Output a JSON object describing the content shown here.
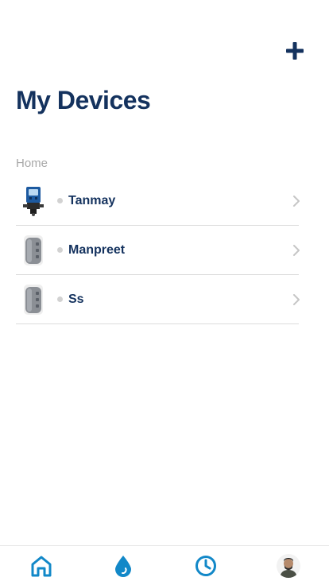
{
  "header": {
    "title": "My Devices",
    "add_icon": "plus-icon"
  },
  "section": {
    "label": "Home"
  },
  "devices": [
    {
      "name": "Tanmay",
      "thumbnail": "water-meter-device-image",
      "status_color": "#d2d2d2"
    },
    {
      "name": "Manpreet",
      "thumbnail": "water-tank-device-image",
      "status_color": "#d2d2d2"
    },
    {
      "name": "Ss",
      "thumbnail": "water-tank-device-image",
      "status_color": "#d2d2d2"
    }
  ],
  "tabbar": {
    "items": [
      {
        "icon": "home-icon",
        "active": true
      },
      {
        "icon": "water-drop-icon",
        "active": false
      },
      {
        "icon": "clock-icon",
        "active": false
      },
      {
        "icon": "profile-avatar",
        "active": false
      }
    ]
  },
  "colors": {
    "primary": "#14325e",
    "accent": "#1288c8",
    "muted": "#a8a8a8",
    "divider": "#dcdcdc"
  }
}
